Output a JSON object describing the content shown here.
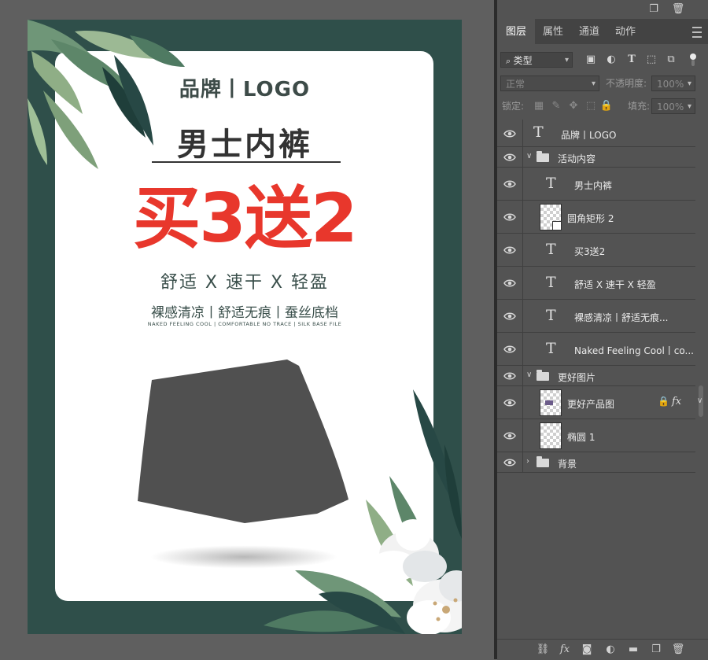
{
  "poster": {
    "brand": "品牌丨LOGO",
    "title": "男士内裤",
    "promo": "买3送2",
    "features": "舒适 X 速干 X 轻盈",
    "benefits": "裸感清凉丨舒适无痕丨蚕丝底档",
    "benefits_en": "NAKED FEELING COOL | COMFORTABLE NO TRACE | SILK BASE FILE",
    "colors": {
      "background": "#2f4f4a",
      "card": "#ffffff",
      "promo": "#e8372c",
      "text": "#333333",
      "product": "#505050"
    }
  },
  "layers_panel": {
    "tabs": [
      {
        "label": "图层",
        "active": true
      },
      {
        "label": "属性",
        "active": false
      },
      {
        "label": "通道",
        "active": false
      },
      {
        "label": "动作",
        "active": false
      }
    ],
    "filter_select": "类型",
    "blend_mode": "正常",
    "opacity_label": "不透明度:",
    "opacity_value": "100%",
    "lock_label": "锁定:",
    "fill_label": "填充:",
    "fill_value": "100%",
    "layers": [
      {
        "name": "品牌丨LOGO",
        "kind": "text",
        "indent": 0
      },
      {
        "name": "活动内容",
        "kind": "group",
        "expanded": true,
        "indent": 0
      },
      {
        "name": "男士内裤",
        "kind": "text",
        "indent": 1
      },
      {
        "name": "圆角矩形 2",
        "kind": "shape",
        "indent": 1
      },
      {
        "name": "买3送2",
        "kind": "text",
        "indent": 1
      },
      {
        "name": "舒适 X 速干 X 轻盈",
        "kind": "text",
        "indent": 1
      },
      {
        "name": "裸感清凉丨舒适无痕...",
        "kind": "text",
        "indent": 1
      },
      {
        "name": "Naked Feeling Cool丨co...",
        "kind": "text",
        "indent": 1
      },
      {
        "name": "更好图片",
        "kind": "group",
        "expanded": true,
        "indent": 0
      },
      {
        "name": "更好产品图",
        "kind": "image",
        "indent": 1,
        "locked": true,
        "fx": "fx"
      },
      {
        "name": "椭圆 1",
        "kind": "image",
        "indent": 1
      },
      {
        "name": "背景",
        "kind": "group",
        "expanded": false,
        "indent": 0
      }
    ]
  },
  "icons": [
    "new-layer-icon",
    "trash-icon",
    "panel-menu-icon",
    "eye-icon",
    "text-layer-icon",
    "folder-icon",
    "lock-icon",
    "link-icon",
    "fx-icon",
    "mask-icon",
    "adjustment-icon",
    "group-icon"
  ]
}
